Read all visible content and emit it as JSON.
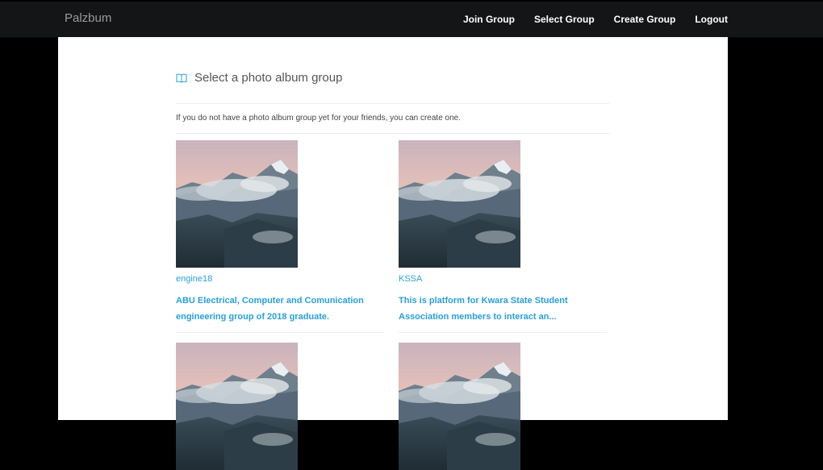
{
  "navbar": {
    "brand": "Palzbum",
    "links": [
      {
        "label": "Join Group"
      },
      {
        "label": "Select Group"
      },
      {
        "label": "Create Group"
      },
      {
        "label": "Logout"
      }
    ]
  },
  "page": {
    "heading_icon": "book-icon",
    "heading": "Select a photo album group",
    "intro": "If you do not have a photo album group yet for your friends, you can create one."
  },
  "groups": [
    {
      "title": "engine18",
      "description": "ABU Electrical, Computer and Comunication engineering group of 2018 graduate."
    },
    {
      "title": "KSSA",
      "description": "This is platform for Kwara State Student Association members to interact an..."
    },
    {
      "title": "",
      "description": ""
    },
    {
      "title": "",
      "description": ""
    }
  ],
  "colors": {
    "link": "#2a9fd6",
    "navbar": "#141517",
    "accent_icon": "#2a9fd6"
  }
}
